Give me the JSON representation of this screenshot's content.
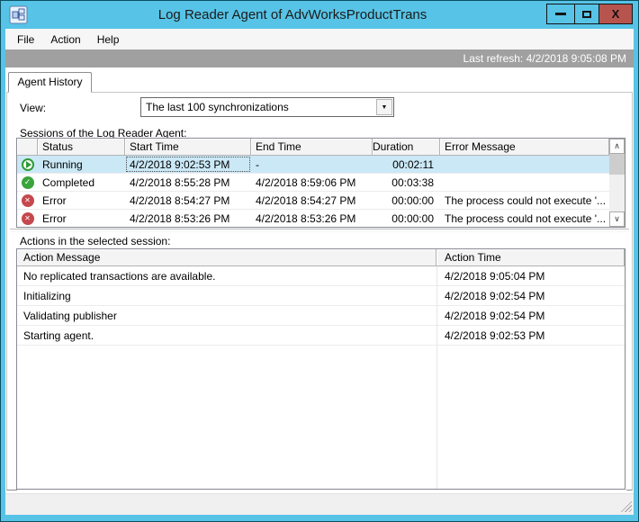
{
  "window": {
    "title": "Log Reader Agent of AdvWorksProductTrans",
    "close_label": "X"
  },
  "menu": {
    "items": [
      "File",
      "Action",
      "Help"
    ]
  },
  "refresh_bar": {
    "text": "Last refresh: 4/2/2018 9:05:08 PM"
  },
  "tab": {
    "label": "Agent History"
  },
  "view": {
    "label": "View:",
    "value": "The last 100 synchronizations"
  },
  "sessions": {
    "caption": "Sessions of the Log Reader Agent:",
    "columns": [
      "",
      "Status",
      "Start Time",
      "End Time",
      "Duration",
      "Error Message"
    ],
    "rows": [
      {
        "icon": "running",
        "status": "Running",
        "start": "4/2/2018 9:02:53 PM",
        "end": "-",
        "duration": "00:02:11",
        "error": "",
        "selected": true
      },
      {
        "icon": "completed",
        "status": "Completed",
        "start": "4/2/2018 8:55:28 PM",
        "end": "4/2/2018 8:59:06 PM",
        "duration": "00:03:38",
        "error": "",
        "selected": false
      },
      {
        "icon": "error",
        "status": "Error",
        "start": "4/2/2018 8:54:27 PM",
        "end": "4/2/2018 8:54:27 PM",
        "duration": "00:00:00",
        "error": "The process could not execute '...",
        "selected": false
      },
      {
        "icon": "error",
        "status": "Error",
        "start": "4/2/2018 8:53:26 PM",
        "end": "4/2/2018 8:53:26 PM",
        "duration": "00:00:00",
        "error": "The process could not execute '...",
        "selected": false
      }
    ]
  },
  "actions": {
    "caption": "Actions in the selected session:",
    "columns": [
      "Action Message",
      "Action Time"
    ],
    "rows": [
      {
        "message": "No replicated transactions are available.",
        "time": "4/2/2018 9:05:04 PM"
      },
      {
        "message": "Initializing",
        "time": "4/2/2018 9:02:54 PM"
      },
      {
        "message": "Validating publisher",
        "time": "4/2/2018 9:02:54 PM"
      },
      {
        "message": "Starting agent.",
        "time": "4/2/2018 9:02:53 PM"
      }
    ]
  },
  "icons": {
    "completed_glyph": "✓",
    "error_glyph": "✕",
    "combo_arrow": "▼",
    "scroll_up": "∧",
    "scroll_down": "∨"
  },
  "colors": {
    "titlebar": "#57c3e6",
    "close_button": "#b8544e",
    "refresh_bar": "#a0a0a0",
    "selected_row": "#cbe8f6",
    "running_green": "#2e9b33",
    "completed_green": "#3ba33c",
    "error_red": "#c5484d"
  }
}
